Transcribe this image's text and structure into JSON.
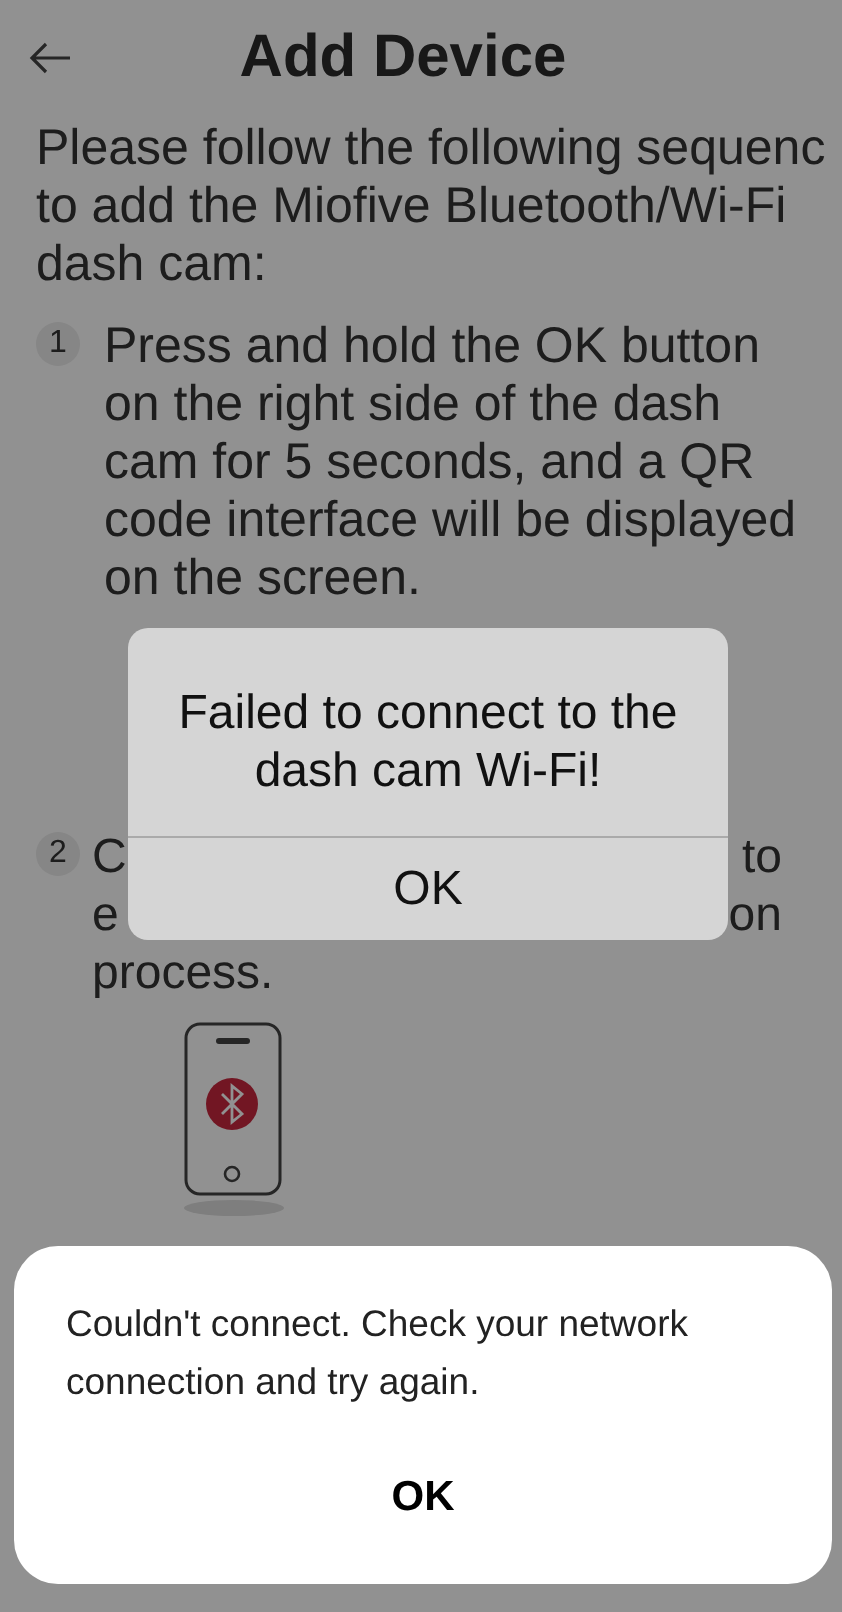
{
  "header": {
    "back_icon": true,
    "title": "Add Device"
  },
  "intro": [
    "Please follow the following sequenc",
    "to add the Miofive Bluetooth/Wi-Fi",
    "dash cam:"
  ],
  "steps": [
    {
      "number": "1",
      "kind": "text",
      "text": "Press and hold the OK button on the right side of the dash cam for 5 seconds, and a QR code interface will be displayed on the screen."
    },
    {
      "number": "2",
      "kind": "fragments",
      "lines": [
        [
          "C",
          "to"
        ],
        [
          "e",
          "on"
        ],
        [
          "process."
        ]
      ]
    }
  ],
  "dialog": {
    "message": "Failed to connect to the dash cam Wi-Fi!",
    "button": "OK"
  },
  "sheet": {
    "message": "Couldn't connect. Check your network connection and try again.",
    "button": "OK"
  }
}
